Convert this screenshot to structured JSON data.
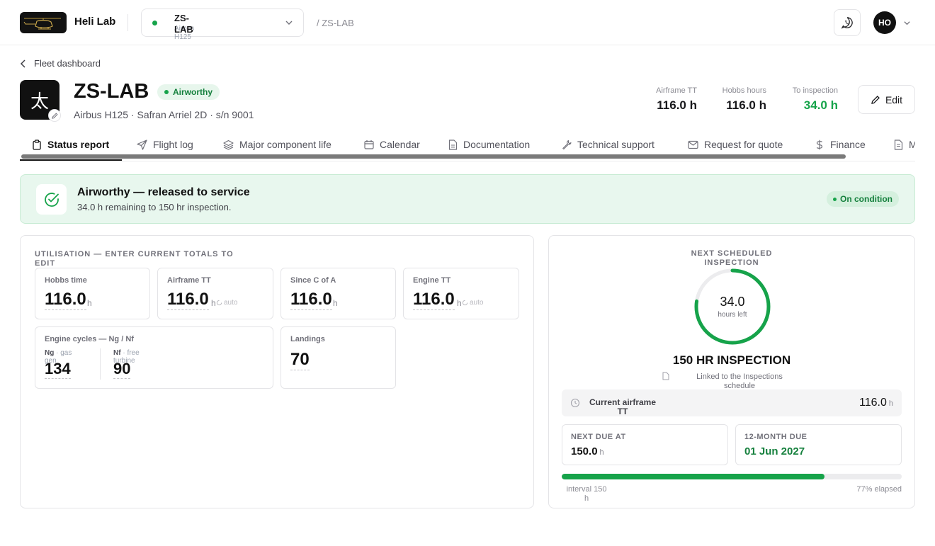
{
  "topbar": {
    "brand": "Heli Lab",
    "aircraft_registration": "ZS-LAB",
    "aircraft_model": "Airbus H125",
    "breadcrumb": "/ ZS-LAB",
    "user_initials": "HO"
  },
  "header": {
    "back_label": "Fleet dashboard",
    "icon_glyph": "太",
    "title": "ZS-LAB",
    "status": "Airworthy",
    "subtitle": "Airbus H125 · Safran Arriel 2D · s/n 9001",
    "stats": [
      {
        "label": "Airframe TT",
        "value": "116.0 h"
      },
      {
        "label": "Hobbs hours",
        "value": "116.0 h"
      },
      {
        "label": "To inspection",
        "value": "34.0 h"
      }
    ],
    "edit_label": "Edit"
  },
  "tabs": [
    {
      "label": "Status report",
      "icon": "clipboard-icon"
    },
    {
      "label": "Flight log",
      "icon": "send-icon"
    },
    {
      "label": "Major component life",
      "icon": "layers-icon"
    },
    {
      "label": "Calendar",
      "icon": "calendar-icon"
    },
    {
      "label": "Documentation",
      "icon": "file-icon"
    },
    {
      "label": "Technical support",
      "icon": "wrench-icon"
    },
    {
      "label": "Request for quote",
      "icon": "mail-icon"
    },
    {
      "label": "Finance",
      "icon": "dollar-icon"
    },
    {
      "label": "M",
      "icon": "document-icon"
    }
  ],
  "banner": {
    "title": "Airworthy — released to service",
    "subtitle": "34.0 h remaining to 150 hr inspection.",
    "badge": "On condition"
  },
  "utilisation": {
    "heading": "UTILISATION — ENTER CURRENT TOTALS TO EDIT",
    "tiles": [
      {
        "label": "Hobbs time",
        "value": "116.0",
        "unit": "h"
      },
      {
        "label": "Airframe TT",
        "value": "116.0",
        "unit": "h",
        "auto": "auto"
      },
      {
        "label": "Since C of A",
        "value": "116.0",
        "unit": "h"
      },
      {
        "label": "Engine TT",
        "value": "116.0",
        "unit": "h",
        "auto": "auto"
      }
    ],
    "cycles": {
      "label": "Engine cycles — Ng / Nf",
      "ng_code": "Ng",
      "ng_desc": "· gas gen",
      "ng_value": "134",
      "nf_code": "Nf",
      "nf_desc": "· free turbine",
      "nf_value": "90"
    },
    "landings": {
      "label": "Landings",
      "value": "70"
    }
  },
  "inspection": {
    "heading": "NEXT SCHEDULED INSPECTION",
    "hours_left": "34.0",
    "hours_left_label": "hours left",
    "ring_fraction": 0.773,
    "name": "150 HR INSPECTION",
    "linked": "Linked to the Inspections schedule",
    "current_label": "Current airframe TT",
    "current_value": "116.0",
    "current_unit": "h",
    "next_due_label": "NEXT DUE AT",
    "next_due_value": "150.0",
    "next_due_unit": "h",
    "month_due_label": "12-MONTH DUE",
    "month_due_value": "01 Jun 2027",
    "progress_fraction": 0.773,
    "interval_label": "interval 150 h",
    "elapsed_label": "77% elapsed"
  },
  "colors": {
    "accent_green": "#16a34a",
    "banner_bg": "#e8f7ee",
    "dark": "#111111"
  }
}
